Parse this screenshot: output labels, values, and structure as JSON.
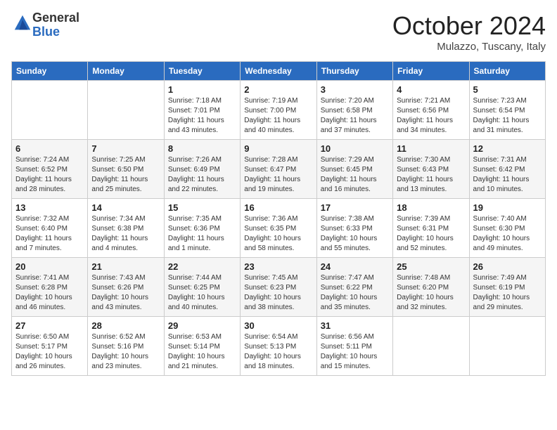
{
  "header": {
    "logo_line1": "General",
    "logo_line2": "Blue",
    "month_title": "October 2024",
    "subtitle": "Mulazzo, Tuscany, Italy"
  },
  "days_of_week": [
    "Sunday",
    "Monday",
    "Tuesday",
    "Wednesday",
    "Thursday",
    "Friday",
    "Saturday"
  ],
  "weeks": [
    [
      {
        "day": "",
        "info": ""
      },
      {
        "day": "",
        "info": ""
      },
      {
        "day": "1",
        "info": "Sunrise: 7:18 AM\nSunset: 7:01 PM\nDaylight: 11 hours and 43 minutes."
      },
      {
        "day": "2",
        "info": "Sunrise: 7:19 AM\nSunset: 7:00 PM\nDaylight: 11 hours and 40 minutes."
      },
      {
        "day": "3",
        "info": "Sunrise: 7:20 AM\nSunset: 6:58 PM\nDaylight: 11 hours and 37 minutes."
      },
      {
        "day": "4",
        "info": "Sunrise: 7:21 AM\nSunset: 6:56 PM\nDaylight: 11 hours and 34 minutes."
      },
      {
        "day": "5",
        "info": "Sunrise: 7:23 AM\nSunset: 6:54 PM\nDaylight: 11 hours and 31 minutes."
      }
    ],
    [
      {
        "day": "6",
        "info": "Sunrise: 7:24 AM\nSunset: 6:52 PM\nDaylight: 11 hours and 28 minutes."
      },
      {
        "day": "7",
        "info": "Sunrise: 7:25 AM\nSunset: 6:50 PM\nDaylight: 11 hours and 25 minutes."
      },
      {
        "day": "8",
        "info": "Sunrise: 7:26 AM\nSunset: 6:49 PM\nDaylight: 11 hours and 22 minutes."
      },
      {
        "day": "9",
        "info": "Sunrise: 7:28 AM\nSunset: 6:47 PM\nDaylight: 11 hours and 19 minutes."
      },
      {
        "day": "10",
        "info": "Sunrise: 7:29 AM\nSunset: 6:45 PM\nDaylight: 11 hours and 16 minutes."
      },
      {
        "day": "11",
        "info": "Sunrise: 7:30 AM\nSunset: 6:43 PM\nDaylight: 11 hours and 13 minutes."
      },
      {
        "day": "12",
        "info": "Sunrise: 7:31 AM\nSunset: 6:42 PM\nDaylight: 11 hours and 10 minutes."
      }
    ],
    [
      {
        "day": "13",
        "info": "Sunrise: 7:32 AM\nSunset: 6:40 PM\nDaylight: 11 hours and 7 minutes."
      },
      {
        "day": "14",
        "info": "Sunrise: 7:34 AM\nSunset: 6:38 PM\nDaylight: 11 hours and 4 minutes."
      },
      {
        "day": "15",
        "info": "Sunrise: 7:35 AM\nSunset: 6:36 PM\nDaylight: 11 hours and 1 minute."
      },
      {
        "day": "16",
        "info": "Sunrise: 7:36 AM\nSunset: 6:35 PM\nDaylight: 10 hours and 58 minutes."
      },
      {
        "day": "17",
        "info": "Sunrise: 7:38 AM\nSunset: 6:33 PM\nDaylight: 10 hours and 55 minutes."
      },
      {
        "day": "18",
        "info": "Sunrise: 7:39 AM\nSunset: 6:31 PM\nDaylight: 10 hours and 52 minutes."
      },
      {
        "day": "19",
        "info": "Sunrise: 7:40 AM\nSunset: 6:30 PM\nDaylight: 10 hours and 49 minutes."
      }
    ],
    [
      {
        "day": "20",
        "info": "Sunrise: 7:41 AM\nSunset: 6:28 PM\nDaylight: 10 hours and 46 minutes."
      },
      {
        "day": "21",
        "info": "Sunrise: 7:43 AM\nSunset: 6:26 PM\nDaylight: 10 hours and 43 minutes."
      },
      {
        "day": "22",
        "info": "Sunrise: 7:44 AM\nSunset: 6:25 PM\nDaylight: 10 hours and 40 minutes."
      },
      {
        "day": "23",
        "info": "Sunrise: 7:45 AM\nSunset: 6:23 PM\nDaylight: 10 hours and 38 minutes."
      },
      {
        "day": "24",
        "info": "Sunrise: 7:47 AM\nSunset: 6:22 PM\nDaylight: 10 hours and 35 minutes."
      },
      {
        "day": "25",
        "info": "Sunrise: 7:48 AM\nSunset: 6:20 PM\nDaylight: 10 hours and 32 minutes."
      },
      {
        "day": "26",
        "info": "Sunrise: 7:49 AM\nSunset: 6:19 PM\nDaylight: 10 hours and 29 minutes."
      }
    ],
    [
      {
        "day": "27",
        "info": "Sunrise: 6:50 AM\nSunset: 5:17 PM\nDaylight: 10 hours and 26 minutes."
      },
      {
        "day": "28",
        "info": "Sunrise: 6:52 AM\nSunset: 5:16 PM\nDaylight: 10 hours and 23 minutes."
      },
      {
        "day": "29",
        "info": "Sunrise: 6:53 AM\nSunset: 5:14 PM\nDaylight: 10 hours and 21 minutes."
      },
      {
        "day": "30",
        "info": "Sunrise: 6:54 AM\nSunset: 5:13 PM\nDaylight: 10 hours and 18 minutes."
      },
      {
        "day": "31",
        "info": "Sunrise: 6:56 AM\nSunset: 5:11 PM\nDaylight: 10 hours and 15 minutes."
      },
      {
        "day": "",
        "info": ""
      },
      {
        "day": "",
        "info": ""
      }
    ]
  ]
}
